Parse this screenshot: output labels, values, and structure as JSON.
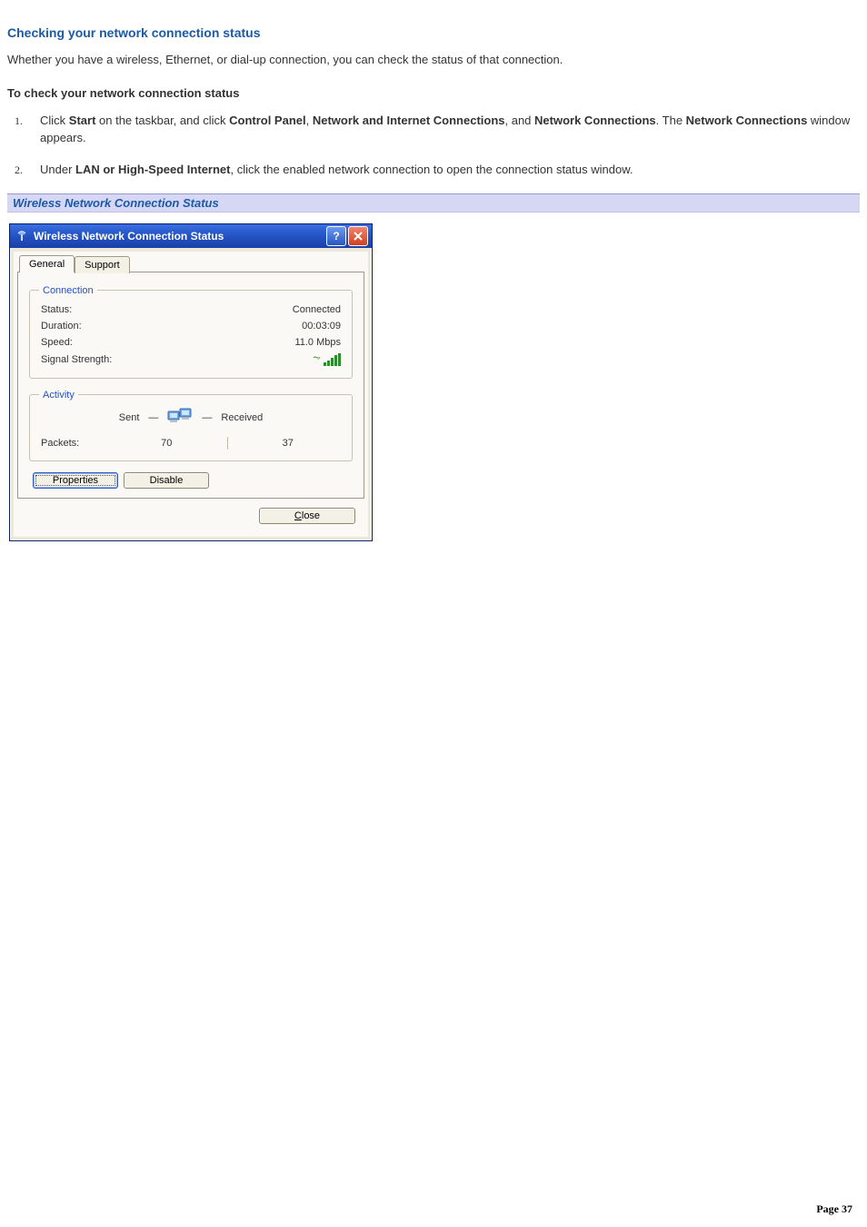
{
  "heading": "Checking your network connection status",
  "intro": "Whether you have a wireless, Ethernet, or dial-up connection, you can check the status of that connection.",
  "procedure_title": "To check your network connection status",
  "steps": [
    {
      "num": "1.",
      "parts": [
        "Click ",
        "Start",
        " on the taskbar, and click ",
        "Control Panel",
        ", ",
        "Network and Internet Connections",
        ", and ",
        "Network Connections",
        ". The ",
        "Network Connections",
        " window appears."
      ]
    },
    {
      "num": "2.",
      "parts": [
        "Under ",
        "LAN or High-Speed Internet",
        ", click the enabled network connection to open the connection status window."
      ]
    }
  ],
  "caption": "Wireless Network Connection Status",
  "dialog": {
    "title": "Wireless Network Connection Status",
    "help_btn": "?",
    "close_x": "X",
    "tabs": {
      "general": "General",
      "support": "Support"
    },
    "connection": {
      "legend": "Connection",
      "status_label": "Status:",
      "status_value": "Connected",
      "duration_label": "Duration:",
      "duration_value": "00:03:09",
      "speed_label": "Speed:",
      "speed_value": "11.0 Mbps",
      "signal_label": "Signal Strength:"
    },
    "activity": {
      "legend": "Activity",
      "sent_label": "Sent",
      "received_label": "Received",
      "packets_label": "Packets:",
      "sent_value": "70",
      "received_value": "37"
    },
    "buttons": {
      "properties": "Properties",
      "disable": "Disable",
      "close": "Close"
    }
  },
  "footer": {
    "label": "Page ",
    "number": "37"
  }
}
